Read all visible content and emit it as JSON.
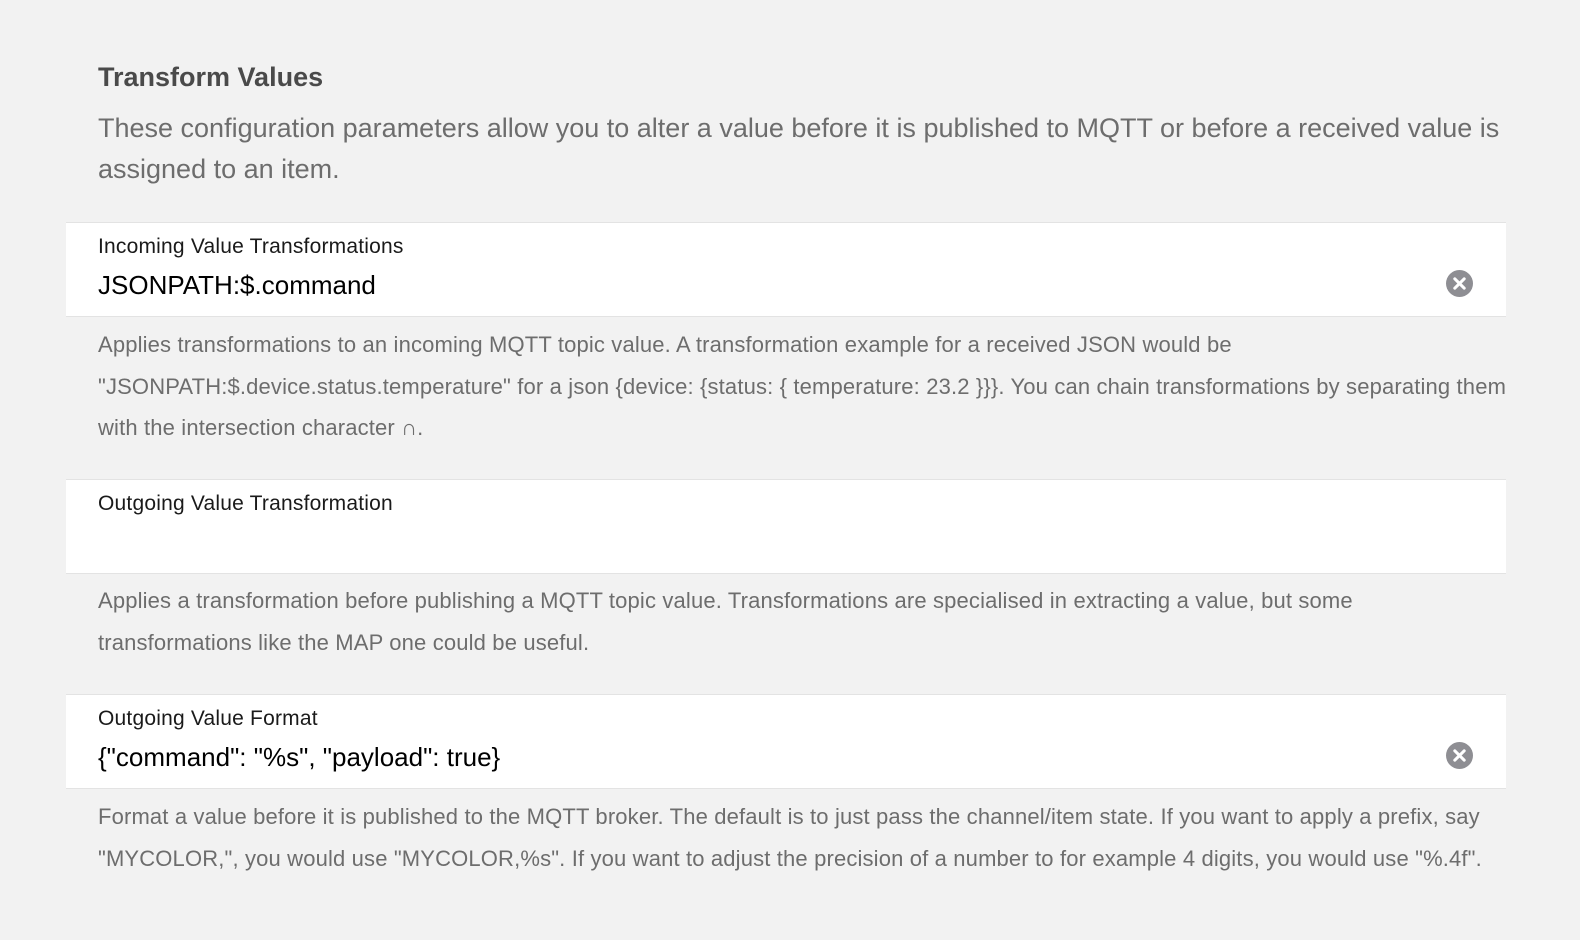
{
  "section": {
    "title": "Transform Values",
    "description": "These configuration parameters allow you to alter a value before it is published to MQTT or before a received value is assigned to an item."
  },
  "fields": [
    {
      "label": "Incoming Value Transformations",
      "value": "JSONPATH:$.command",
      "help": "Applies transformations to an incoming MQTT topic value. A transformation example for a received JSON would be \"JSONPATH:$.device.status.temperature\" for a json {device: {status: { temperature: 23.2 }}}. You can chain transformations by separating them with the intersection character ∩.",
      "clear_icon": "close-circle-icon"
    },
    {
      "label": "Outgoing Value Transformation",
      "value": "",
      "help": "Applies a transformation before publishing a MQTT topic value. Transformations are specialised in extracting a value, but some transformations like the MAP one could be useful."
    },
    {
      "label": "Outgoing Value Format",
      "value": "{\"command\": \"%s\", \"payload\": true}",
      "help": "Format a value before it is published to the MQTT broker. The default is to just pass the channel/item state. If you want to apply a prefix, say \"MYCOLOR,\", you would use \"MYCOLOR,%s\". If you want to adjust the precision of a number to for example 4 digits, you would use \"%.4f\".",
      "clear_icon": "close-circle-icon"
    }
  ],
  "colors": {
    "background": "#f2f2f2",
    "field_background": "#ffffff",
    "help_text": "#6d6d6d",
    "clear_button": "#8e8e93"
  }
}
